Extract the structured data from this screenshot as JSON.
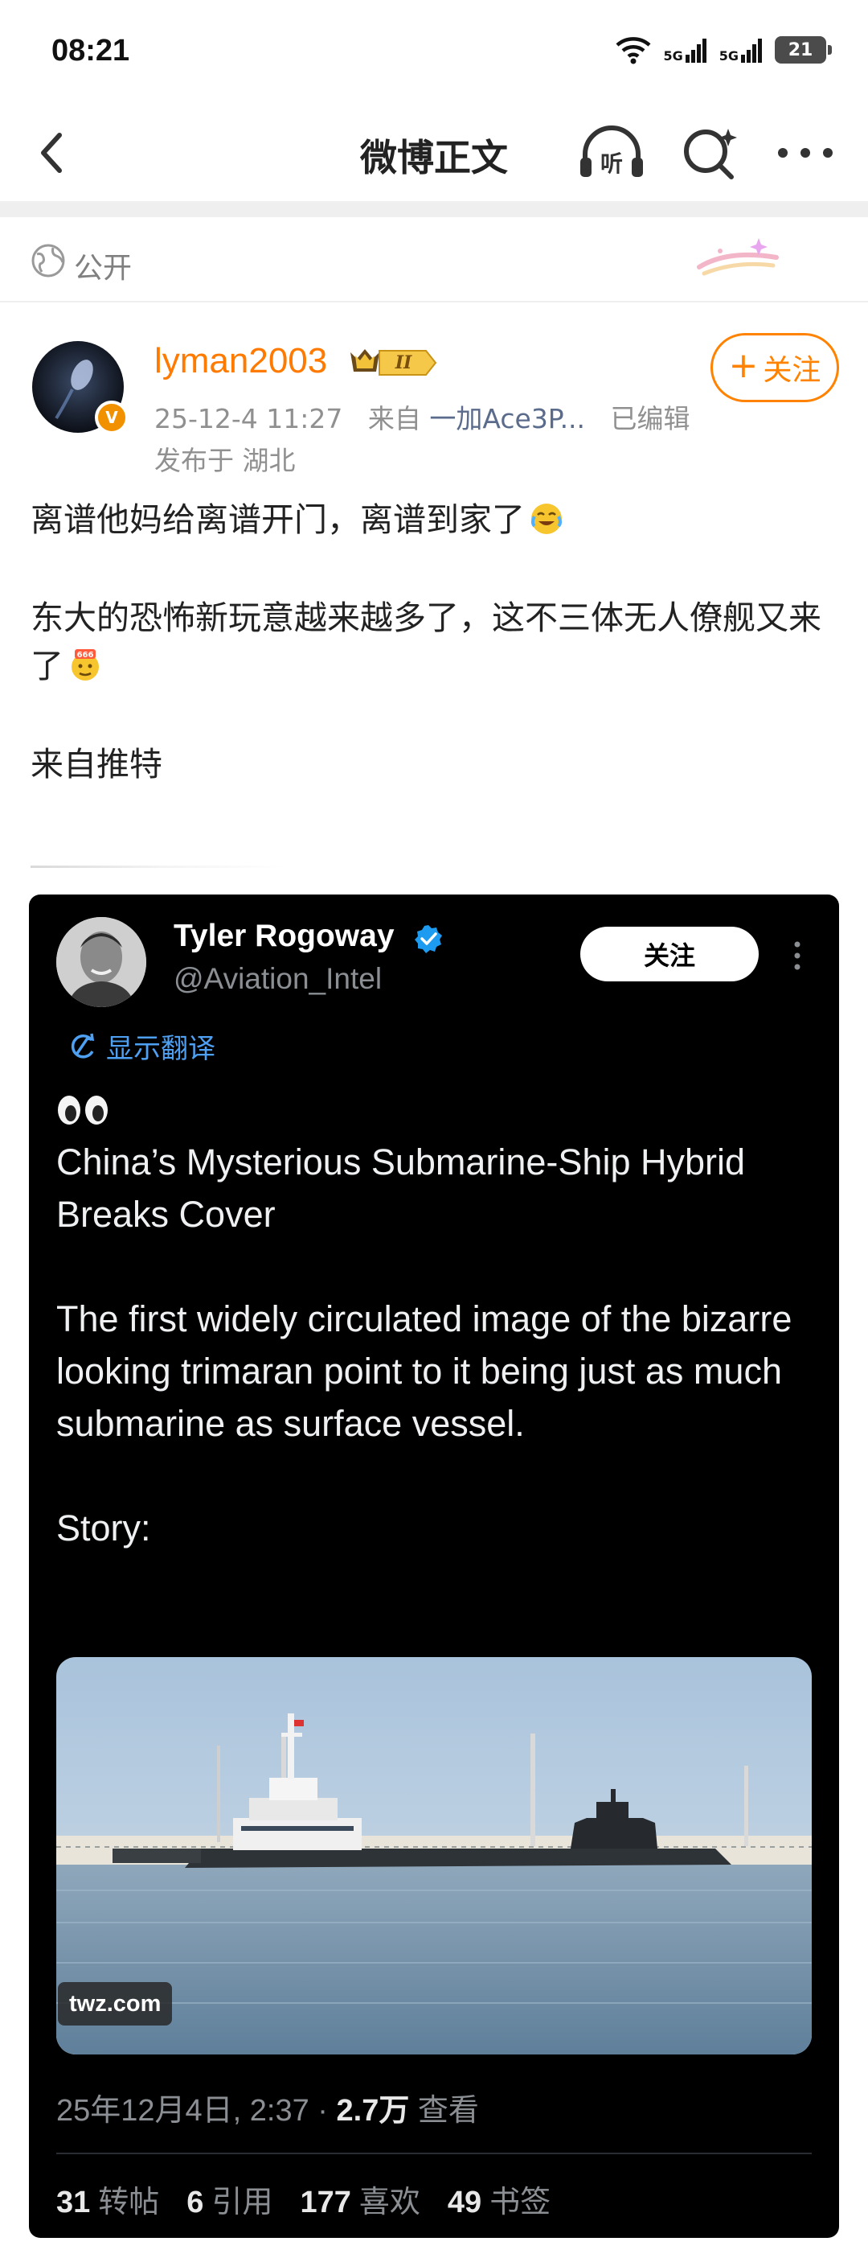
{
  "status_bar": {
    "time": "08:21",
    "net1": "5G",
    "net2": "5G",
    "battery": "21"
  },
  "nav": {
    "title": "微博正文",
    "listen_label": "听"
  },
  "visibility": {
    "label": "公开"
  },
  "author": {
    "name": "lyman2003",
    "level": "II",
    "verified_badge": "V",
    "timestamp": "25-12-4 11:27",
    "source_prefix": "来自",
    "source": "一加Ace3P...",
    "edited": "已编辑",
    "location": "发布于 湖北",
    "follow_label": "关注"
  },
  "post": {
    "line1": "离谱他妈给离谱开门，离谱到家了",
    "line2": "东大的恐怖新玩意越来越多了，这不三体无人僚舰又来了",
    "line3": "来自推特"
  },
  "tweet": {
    "name": "Tyler Rogoway",
    "handle": "@Aviation_Intel",
    "follow_label": "关注",
    "translate_label": "显示翻译",
    "headline": "China’s Mysterious Submarine-Ship Hybrid Breaks Cover",
    "body": "The first widely circulated image of the bizarre looking trimaran point to it being just as much submarine as surface vessel.",
    "story_label": "Story:",
    "image_tag": "twz.com",
    "date": "25年12月4日, 2:37 · ",
    "views_count": "2.7万",
    "views_label": "查看",
    "stats": [
      {
        "num": "31",
        "label": "转帖"
      },
      {
        "num": "6",
        "label": "引用"
      },
      {
        "num": "177",
        "label": "喜欢"
      },
      {
        "num": "49",
        "label": "书签"
      }
    ]
  },
  "colors": {
    "accent_orange": "#ff8200",
    "link_blue": "#4ea0f2",
    "tweet_bg": "#000000"
  }
}
